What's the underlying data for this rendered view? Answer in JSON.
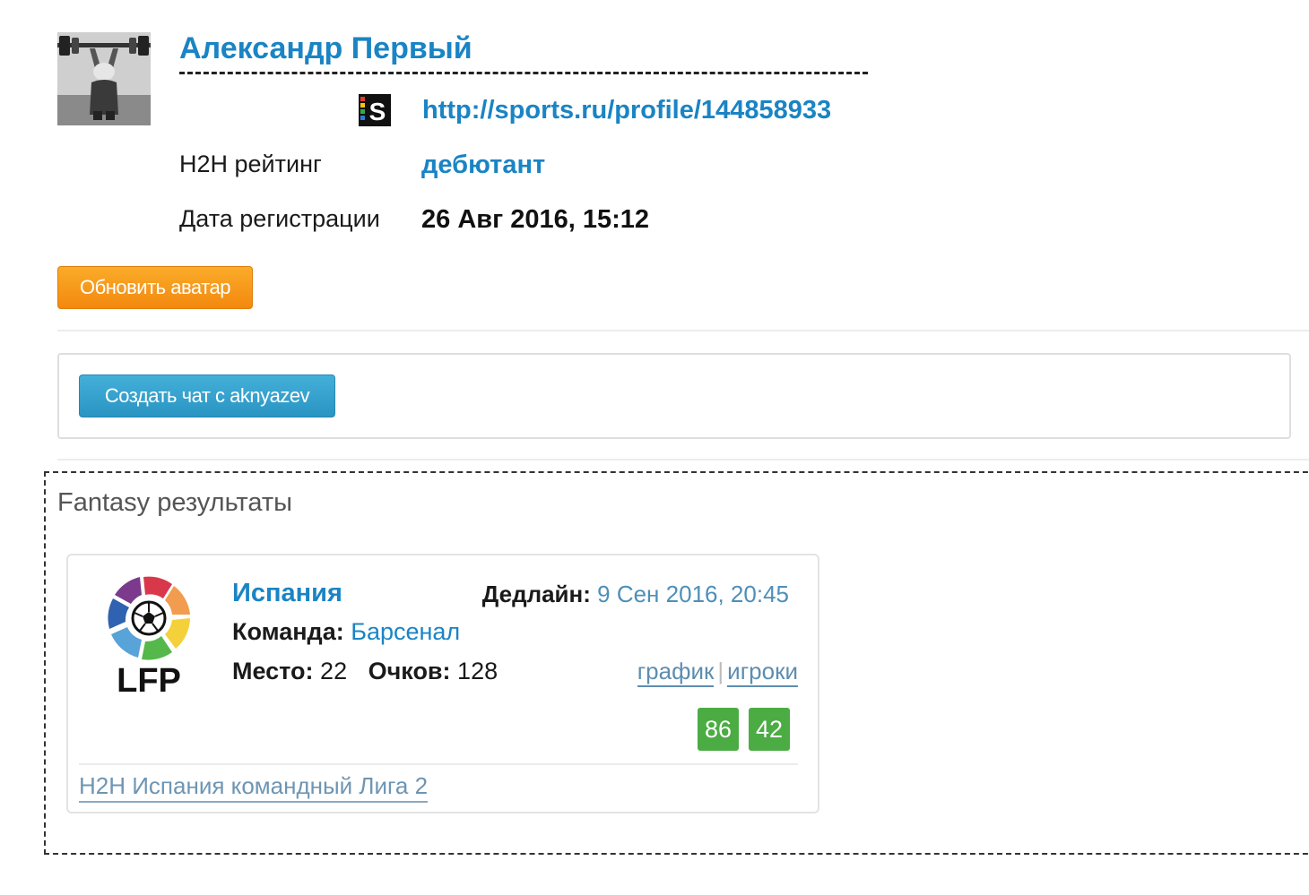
{
  "profile": {
    "name": "Александр Первый",
    "url": "http://sports.ru/profile/144858933",
    "h2h_rating_label": "H2H рейтинг",
    "h2h_rating_value": "дебютант",
    "registration_label": "Дата регистрации",
    "registration_value": "26 Авг 2016, 15:12",
    "update_avatar_button": "Обновить аватар",
    "sports_logo_letter": "S"
  },
  "chat": {
    "create_chat_button": "Создать чат с aknyazev"
  },
  "fantasy": {
    "section_title": "Fantasy результаты",
    "league": {
      "logo_text": "LFP",
      "name": "Испания",
      "deadline_label": "Дедлайн:",
      "deadline_value": "9 Сен 2016, 20:45",
      "team_label": "Команда:",
      "team_value": "Барсенал",
      "place_label": "Место:",
      "place_value": "22",
      "points_label": "Очков:",
      "points_value": "128",
      "link_schedule": "график",
      "link_separator": "|",
      "link_players": "игроки",
      "scores": [
        "86",
        "42"
      ],
      "score_color": "#4cac44",
      "h2h_league_link": "H2H Испания командный Лига 2"
    }
  },
  "colors": {
    "link_blue": "#1a84c4",
    "orange_button": "#f2890e",
    "blue_button": "#2a94c2"
  }
}
